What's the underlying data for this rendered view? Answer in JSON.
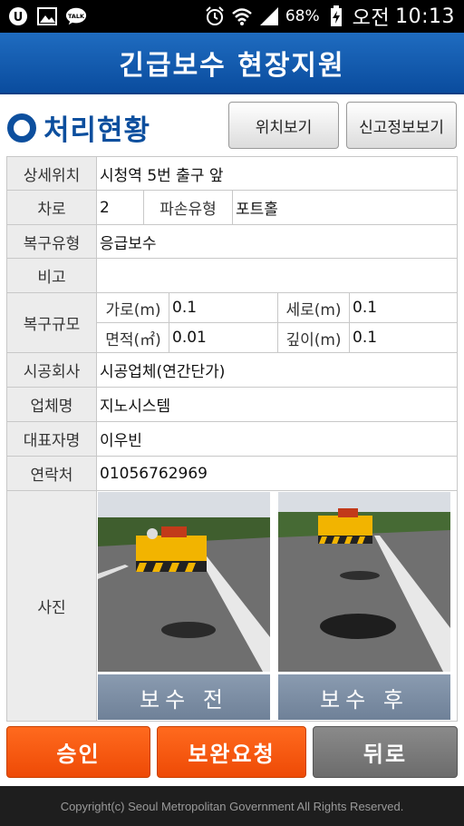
{
  "status_bar": {
    "battery": "68%",
    "time_prefix": "오전",
    "time": "10:13",
    "left_icons": [
      "u-plus-icon",
      "image-icon",
      "talk-icon"
    ],
    "right_icons": [
      "alarm-icon",
      "wifi-icon",
      "signal-icon",
      "battery-charging-icon"
    ]
  },
  "header": {
    "title": "긴급보수 현장지원"
  },
  "section": {
    "title": "처리현황",
    "location_button": "위치보기",
    "report_button": "신고정보보기"
  },
  "details": {
    "detail_location_label": "상세위치",
    "detail_location_value": "시청역 5번 출구 앞",
    "lane_label": "차로",
    "lane_value": "2",
    "damage_type_label": "파손유형",
    "damage_type_value": "포트홀",
    "repair_type_label": "복구유형",
    "repair_type_value": "응급보수",
    "remarks_label": "비고",
    "remarks_value": "",
    "scale_label": "복구규모",
    "width_label": "가로(m)",
    "width_value": "0.1",
    "length_label": "세로(m)",
    "length_value": "0.1",
    "area_label": "면적(㎡)",
    "area_value": "0.01",
    "depth_label": "깊이(m)",
    "depth_value": "0.1",
    "contractor_label": "시공회사",
    "contractor_value": "시공업체(연간단가)",
    "company_label": "업체명",
    "company_value": "지노시스템",
    "representative_label": "대표자명",
    "representative_value": "이우빈",
    "contact_label": "연락처",
    "contact_value": "01056762969",
    "photo_label": "사진"
  },
  "photos": {
    "before_caption": "보수 전",
    "after_caption": "보수 후"
  },
  "actions": {
    "approve": "승인",
    "request_fix": "보완요청",
    "back": "뒤로"
  },
  "footer": {
    "copyright": "Copyright(c) Seoul Metropolitan Government All Rights Reserved."
  },
  "colors": {
    "header": "#0a4c9e",
    "accent_blue": "#0d4f9e",
    "orange": "#ee4a06",
    "gray_button": "#6c6c6c",
    "caption": "#6f8198"
  }
}
